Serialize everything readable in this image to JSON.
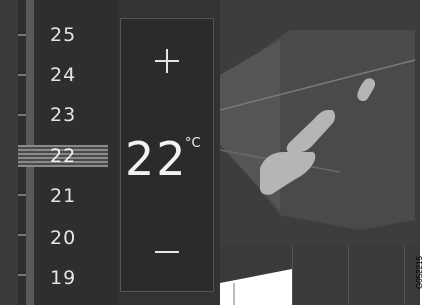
{
  "scale": {
    "labels": [
      "25",
      "24",
      "23",
      "22",
      "21",
      "20",
      "19"
    ],
    "selected": "22"
  },
  "panel": {
    "current_temp": "22",
    "unit": "°C",
    "increase_icon": "plus-icon",
    "decrease_icon": "minus-icon"
  },
  "illustration": {
    "icon": "seat-icon"
  },
  "figure_code": "G052215",
  "colors": {
    "background": "#333333",
    "text": "#e6e6e6",
    "seat": "#b5b5b5"
  }
}
